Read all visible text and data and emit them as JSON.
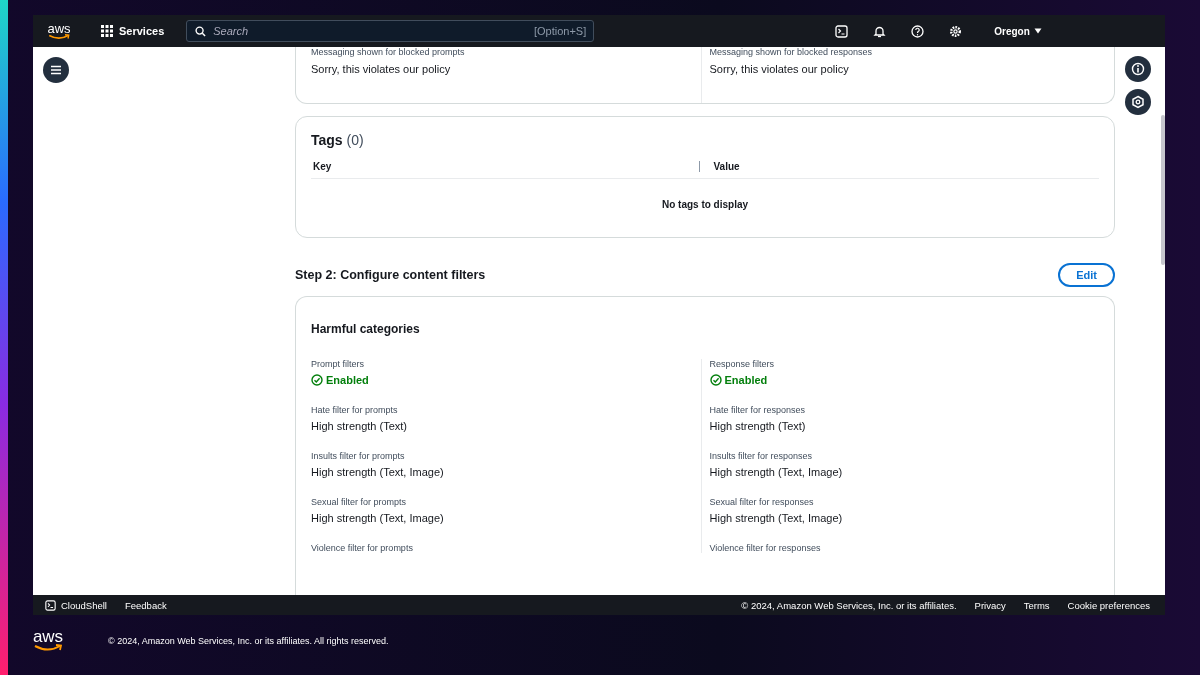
{
  "nav": {
    "logo": "aws",
    "services": "Services",
    "search_placeholder": "Search",
    "shortcut": "[Option+S]",
    "region": "Oregon"
  },
  "messaging": [
    {
      "label": "Messaging shown for blocked prompts",
      "value": "Sorry, this violates our policy"
    },
    {
      "label": "Messaging shown for blocked responses",
      "value": "Sorry, this violates our policy"
    }
  ],
  "tags": {
    "title": "Tags",
    "count": "(0)",
    "columns": [
      "Key",
      "Value"
    ],
    "empty": "No tags to display"
  },
  "step": {
    "title": "Step 2: Configure content filters",
    "edit": "Edit"
  },
  "harmful": {
    "title": "Harmful categories",
    "columns": [
      [
        {
          "kind": "status",
          "label": "Prompt filters",
          "value": "Enabled"
        },
        {
          "kind": "text",
          "label": "Hate filter for prompts",
          "value": "High strength (Text)"
        },
        {
          "kind": "text",
          "label": "Insults filter for prompts",
          "value": "High strength (Text, Image)"
        },
        {
          "kind": "text",
          "label": "Sexual filter for prompts",
          "value": "High strength (Text, Image)"
        },
        {
          "label": "Violence filter for prompts"
        }
      ],
      [
        {
          "kind": "status",
          "label": "Response filters",
          "value": "Enabled"
        },
        {
          "kind": "text",
          "label": "Hate filter for responses",
          "value": "High strength (Text)"
        },
        {
          "kind": "text",
          "label": "Insults filter for responses",
          "value": "High strength (Text, Image)"
        },
        {
          "kind": "text",
          "label": "Sexual filter for responses",
          "value": "High strength (Text, Image)"
        },
        {
          "label": "Violence filter for responses"
        }
      ]
    ]
  },
  "footer": {
    "cloudshell": "CloudShell",
    "feedback": "Feedback",
    "copyright": "© 2024, Amazon Web Services, Inc. or its affiliates.",
    "links": [
      "Privacy",
      "Terms",
      "Cookie preferences"
    ]
  },
  "bottom": {
    "logo": "aws",
    "copyright": "© 2024, Amazon Web Services, Inc. or its affiliates. All rights reserved."
  }
}
